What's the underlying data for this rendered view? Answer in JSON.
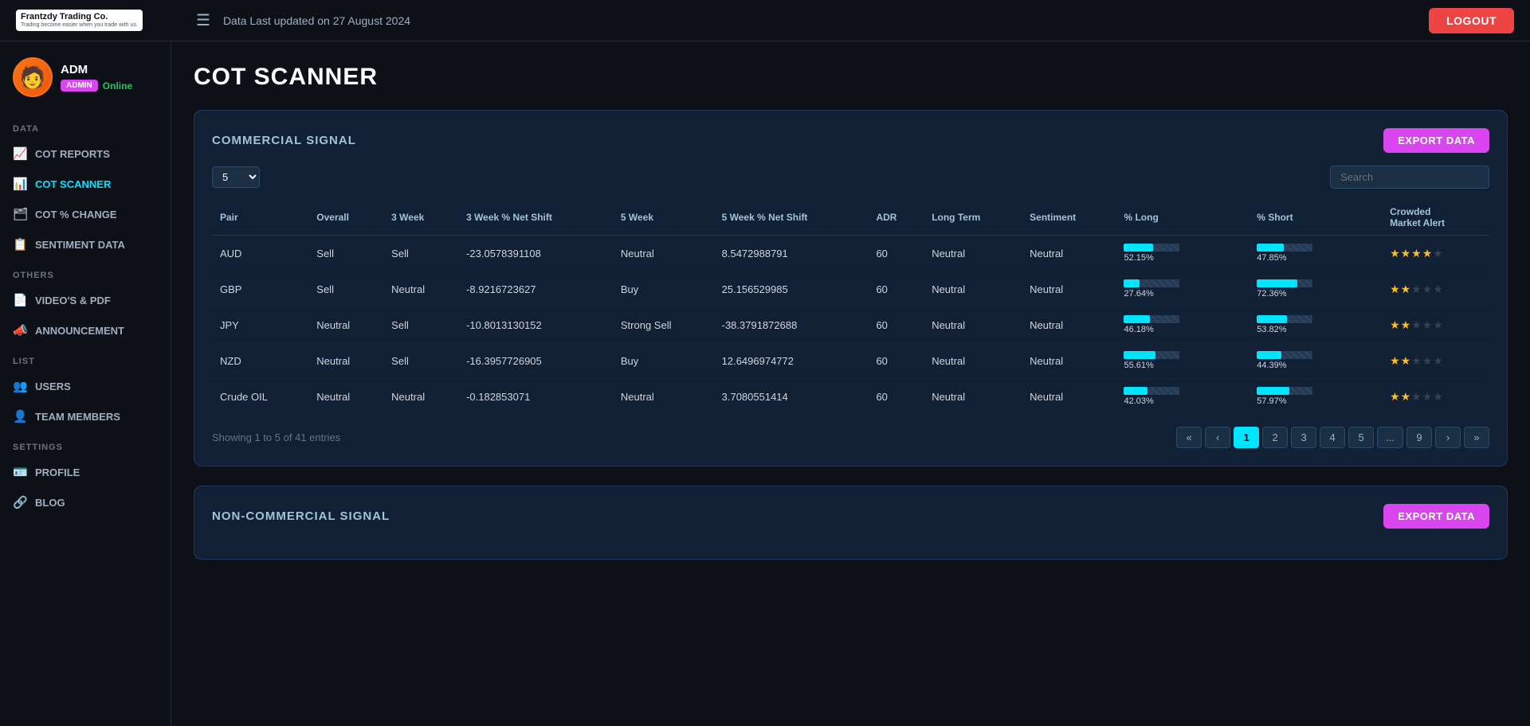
{
  "topbar": {
    "logo_name": "Frantzdy Trading Co.",
    "logo_sub": "Trading become easier when you trade with us.",
    "last_updated": "Data Last updated on 27 August 2024",
    "logout_label": "LOGOUT"
  },
  "sidebar": {
    "profile": {
      "name": "ADM",
      "badge_admin": "ADMIN",
      "badge_online": "Online"
    },
    "sections": [
      {
        "label": "DATA",
        "items": [
          {
            "id": "cot-reports",
            "label": "COT REPORTS",
            "icon": "📈"
          },
          {
            "id": "cot-scanner",
            "label": "COT SCANNER",
            "icon": "📊",
            "active": true
          },
          {
            "id": "cot-change",
            "label": "COT % CHANGE",
            "icon": "🗂"
          },
          {
            "id": "sentiment",
            "label": "SENTIMENT DATA",
            "icon": "📋"
          }
        ]
      },
      {
        "label": "OTHERS",
        "items": [
          {
            "id": "videos",
            "label": "VIDEO'S & PDF",
            "icon": "📄"
          },
          {
            "id": "announcement",
            "label": "ANNOUNCEMENT",
            "icon": "📣"
          }
        ]
      },
      {
        "label": "LIST",
        "items": [
          {
            "id": "users",
            "label": "USERS",
            "icon": "👥"
          },
          {
            "id": "team",
            "label": "TEAM MEMBERS",
            "icon": "👤"
          }
        ]
      },
      {
        "label": "SETTINGS",
        "items": [
          {
            "id": "profile",
            "label": "PROFILE",
            "icon": "🪪"
          },
          {
            "id": "blog",
            "label": "BLOG",
            "icon": "🔗"
          }
        ]
      }
    ]
  },
  "page": {
    "title": "COT SCANNER",
    "commercial": {
      "section_title": "COMMERCIAL SIGNAL",
      "export_label": "EXPORT DATA",
      "entries_value": "5",
      "search_placeholder": "Search",
      "columns": [
        "Pair",
        "Overall",
        "3 Week",
        "3 Week % Net Shift",
        "5 Week",
        "5 Week % Net Shift",
        "ADR",
        "Long Term",
        "Sentiment",
        "% Long",
        "% Short",
        "Crowded Market Alert"
      ],
      "rows": [
        {
          "pair": "AUD",
          "overall": "Sell",
          "week3": "Sell",
          "week3_shift": "-23.0578391108",
          "week5": "Neutral",
          "week5_shift": "8.5472988791",
          "adr": "60",
          "long_term": "Neutral",
          "sentiment": "Neutral",
          "pct_long": "52.15%",
          "pct_long_val": 52,
          "pct_short": "47.85%",
          "pct_short_val": 48,
          "stars": 4
        },
        {
          "pair": "GBP",
          "overall": "Sell",
          "week3": "Neutral",
          "week3_shift": "-8.9216723627",
          "week5": "Buy",
          "week5_shift": "25.156529985",
          "adr": "60",
          "long_term": "Neutral",
          "sentiment": "Neutral",
          "pct_long": "27.64%",
          "pct_long_val": 28,
          "pct_short": "72.36%",
          "pct_short_val": 72,
          "stars": 2
        },
        {
          "pair": "JPY",
          "overall": "Neutral",
          "week3": "Sell",
          "week3_shift": "-10.8013130152",
          "week5": "Strong Sell",
          "week5_shift": "-38.3791872688",
          "adr": "60",
          "long_term": "Neutral",
          "sentiment": "Neutral",
          "pct_long": "46.18%",
          "pct_long_val": 46,
          "pct_short": "53.82%",
          "pct_short_val": 54,
          "stars": 2
        },
        {
          "pair": "NZD",
          "overall": "Neutral",
          "week3": "Sell",
          "week3_shift": "-16.3957726905",
          "week5": "Buy",
          "week5_shift": "12.6496974772",
          "adr": "60",
          "long_term": "Neutral",
          "sentiment": "Neutral",
          "pct_long": "55.61%",
          "pct_long_val": 56,
          "pct_short": "44.39%",
          "pct_short_val": 44,
          "stars": 2
        },
        {
          "pair": "Crude OIL",
          "overall": "Neutral",
          "week3": "Neutral",
          "week3_shift": "-0.182853071",
          "week5": "Neutral",
          "week5_shift": "3.7080551414",
          "adr": "60",
          "long_term": "Neutral",
          "sentiment": "Neutral",
          "pct_long": "42.03%",
          "pct_long_val": 42,
          "pct_short": "57.97%",
          "pct_short_val": 58,
          "stars": 2
        }
      ],
      "showing_text": "Showing 1 to 5 of 41 entries",
      "pagination": {
        "first": "«",
        "prev": "‹",
        "pages": [
          "1",
          "2",
          "3",
          "4",
          "5",
          "...",
          "9"
        ],
        "next": "›",
        "last": "»",
        "active_page": "1"
      }
    },
    "non_commercial": {
      "section_title": "NON-COMMERCIAL SIGNAL",
      "export_label": "EXPORT DATA"
    }
  }
}
